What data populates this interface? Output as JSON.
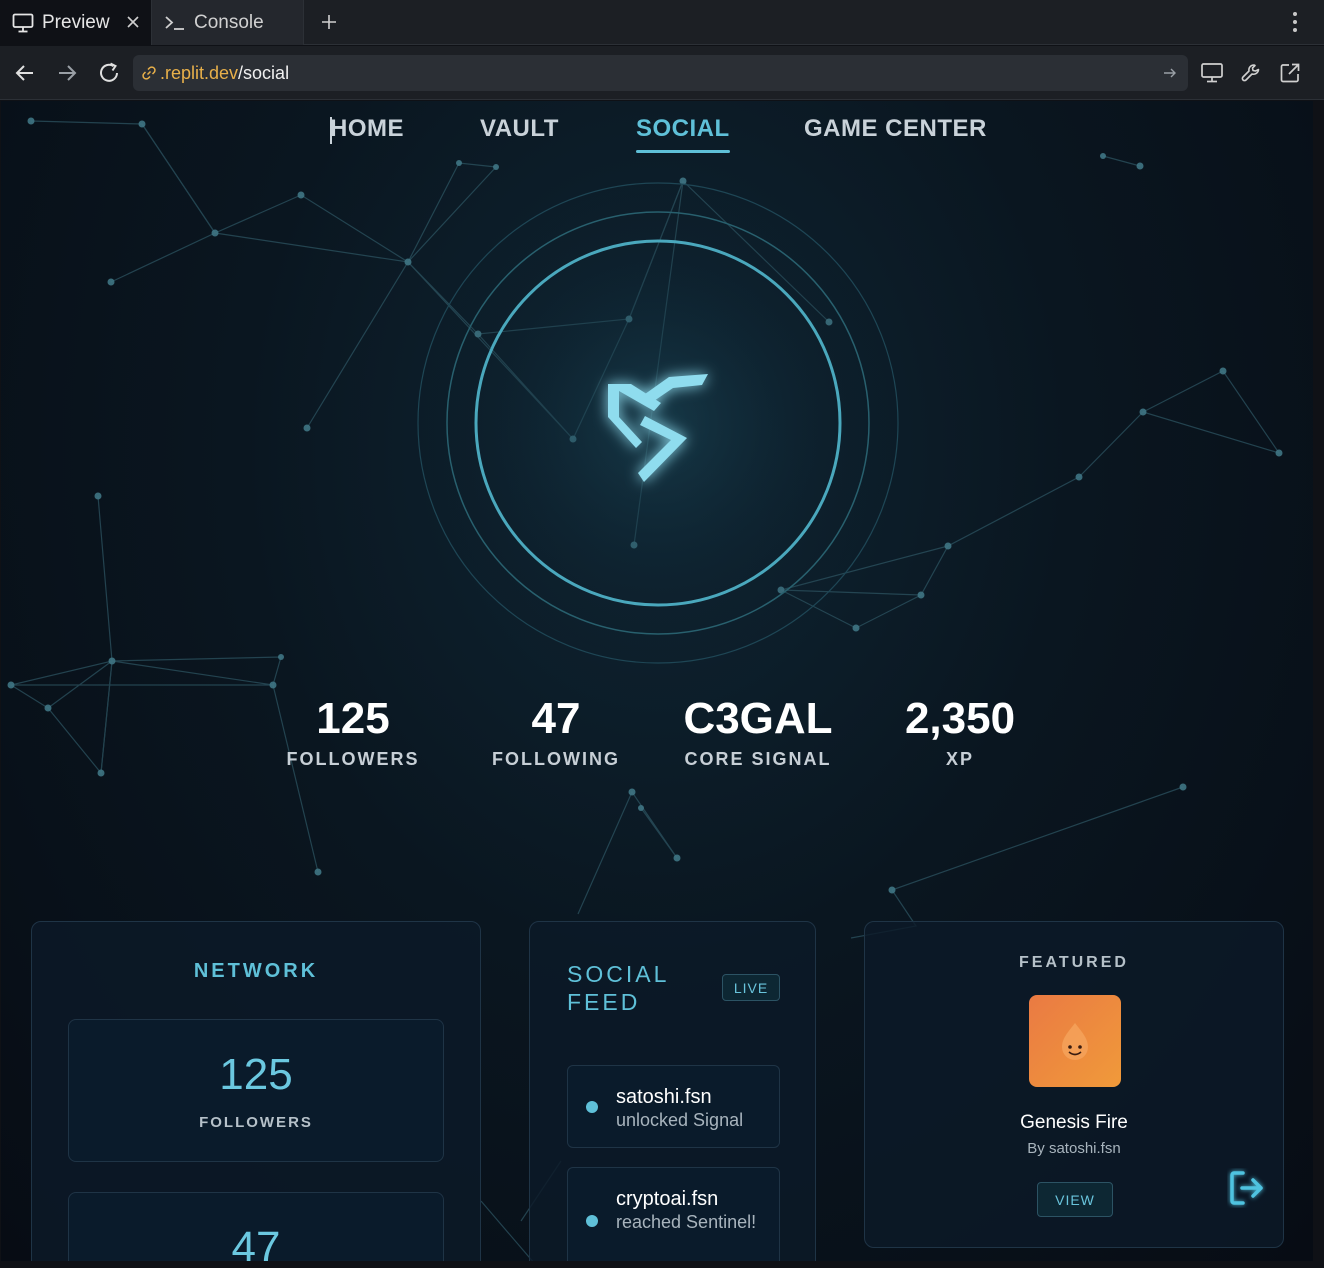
{
  "browser": {
    "tabs": [
      {
        "label": "Preview",
        "icon": "monitor-icon",
        "active": true
      },
      {
        "label": "Console",
        "icon": "terminal-icon",
        "active": false
      }
    ],
    "url": {
      "host": ".replit.dev",
      "path": "/social"
    }
  },
  "nav": {
    "items": [
      {
        "label": "HOME",
        "active": false
      },
      {
        "label": "VAULT",
        "active": false
      },
      {
        "label": "SOCIAL",
        "active": true
      },
      {
        "label": "GAME CENTER",
        "active": false
      }
    ]
  },
  "hero": {
    "logo_icon": "signal-logo-icon",
    "accent": "#5fc0d8"
  },
  "stats": [
    {
      "value": "125",
      "label": "FOLLOWERS"
    },
    {
      "value": "47",
      "label": "FOLLOWING"
    },
    {
      "value": "C3GAL",
      "label": "CORE SIGNAL"
    },
    {
      "value": "2,350",
      "label": "XP"
    }
  ],
  "network": {
    "title": "NETWORK",
    "boxes": [
      {
        "value": "125",
        "label": "FOLLOWERS"
      },
      {
        "value": "47",
        "label": ""
      }
    ]
  },
  "feed": {
    "title": "SOCIAL FEED",
    "badge": "LIVE",
    "items": [
      {
        "user": "satoshi.fsn",
        "action": "unlocked Signal"
      },
      {
        "user": "cryptoai.fsn",
        "action": "reached Sentinel!"
      }
    ]
  },
  "featured": {
    "title": "FEATURED",
    "item_title": "Genesis Fire",
    "by": "By satoshi.fsn",
    "button": "VIEW",
    "thumb_color": "#ec8a3e"
  }
}
